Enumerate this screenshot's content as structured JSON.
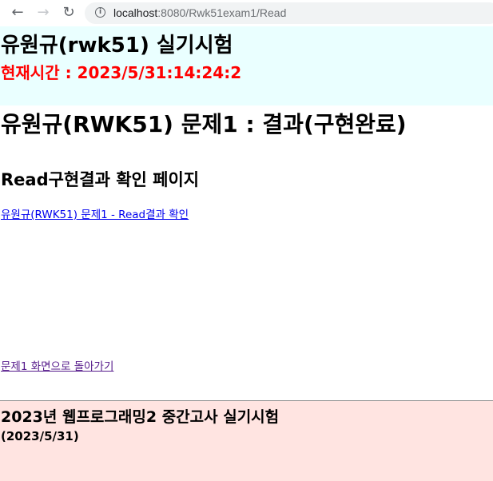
{
  "browser": {
    "url_host": "localhost",
    "url_path": ":8080/Rwk51exam1/Read",
    "icons": {
      "back": "arrow-back-icon",
      "forward": "arrow-forward-icon",
      "reload": "reload-icon",
      "site_info": "info-icon"
    }
  },
  "header": {
    "title": "유원규(rwk51) 실기시험",
    "clock": "현재시간 : 2023/5/31:14:24:2",
    "background": "#eaffff",
    "clock_color": "#ff0000"
  },
  "main": {
    "title": "유원규(RWK51) 문제1 : 결과(구현완료)",
    "subtitle": "Read구현결과 확인 페이지",
    "result_link": "유원규(RWK51) 문제1 - Read결과 확인",
    "back_link": "문제1 화면으로 돌아가기"
  },
  "footer": {
    "title": "2023년 웹프로그래밍2 중간고사 실기시험",
    "date": "(2023/5/31)",
    "background": "#ffe4e1"
  }
}
